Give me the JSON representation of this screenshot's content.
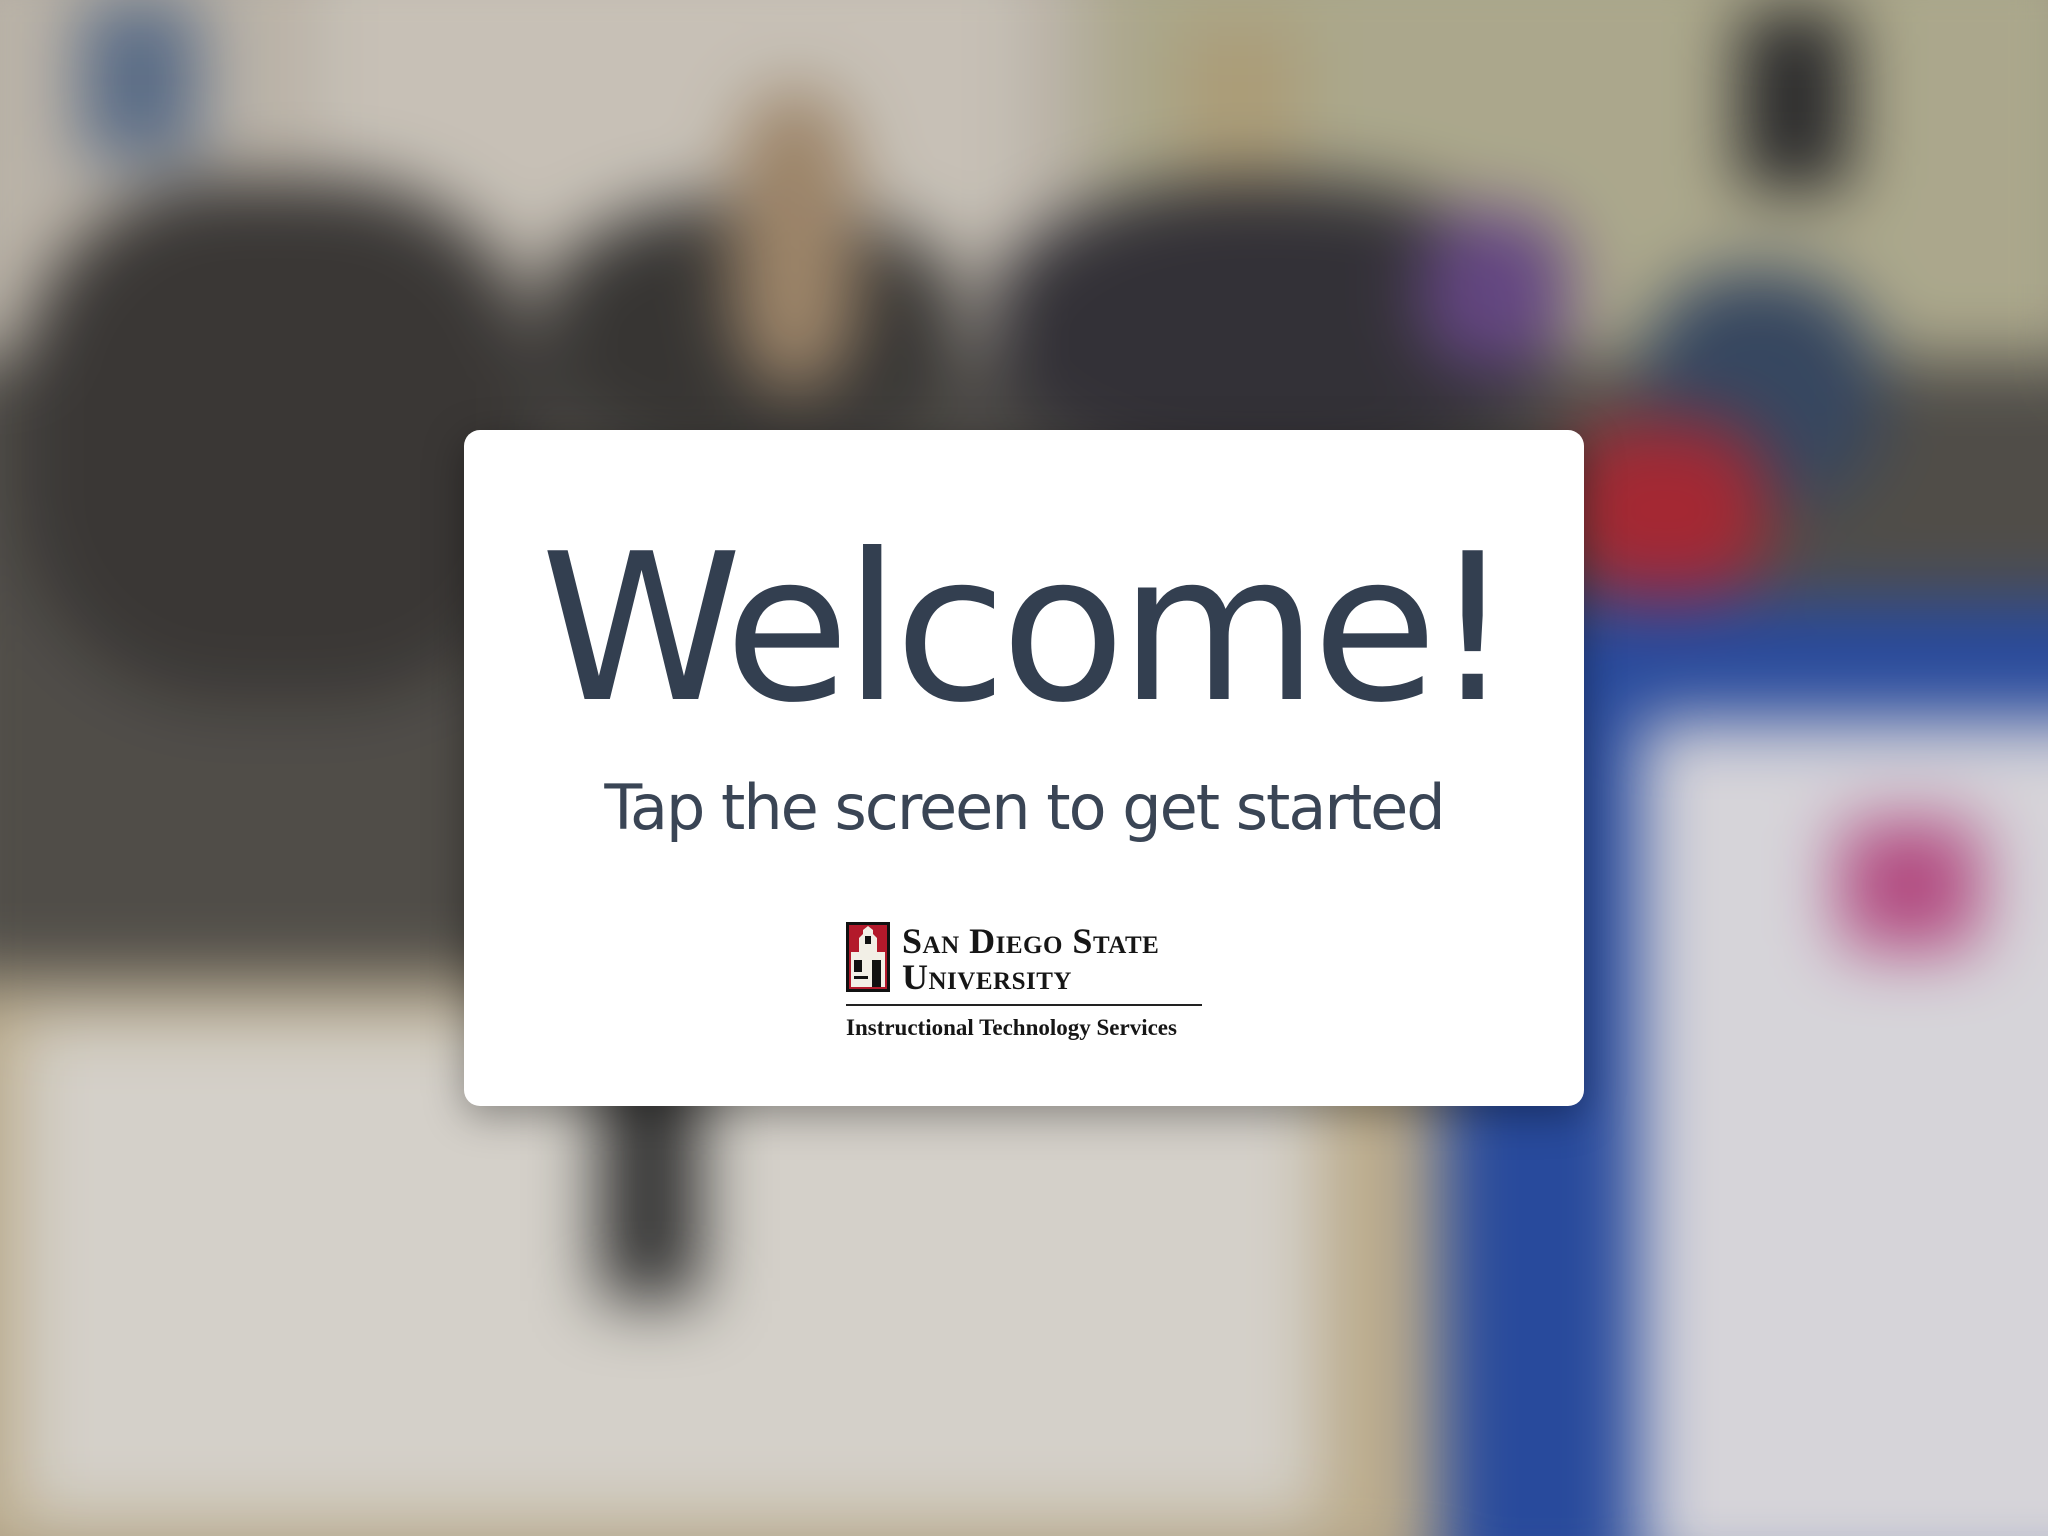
{
  "welcome": {
    "title": "Welcome!",
    "subtitle": "Tap the screen to get started"
  },
  "logo": {
    "university_line1": "San Diego State",
    "university_line2": "University",
    "department": "Instructional Technology Services",
    "seal_icon": "sdsu-tower-seal-icon"
  },
  "colors": {
    "title_text": "#333f50",
    "card_background": "#ffffff",
    "seal_red": "#b3192b"
  }
}
